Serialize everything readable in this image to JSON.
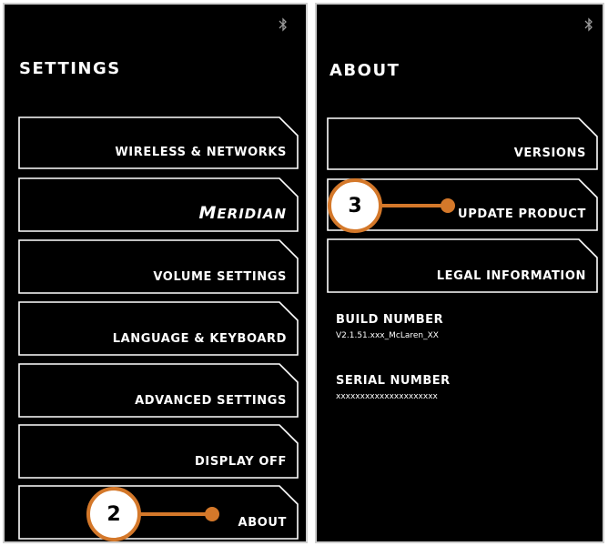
{
  "settings_panel": {
    "title": "SETTINGS",
    "bluetooth_icon": "bluetooth-icon",
    "menu": [
      {
        "label": "WIRELESS & NETWORKS"
      },
      {
        "label": "MERIDIAN"
      },
      {
        "label": "VOLUME SETTINGS"
      },
      {
        "label": "LANGUAGE & KEYBOARD"
      },
      {
        "label": "ADVANCED SETTINGS"
      },
      {
        "label": "DISPLAY OFF"
      },
      {
        "label": "ABOUT"
      }
    ]
  },
  "about_panel": {
    "title": "ABOUT",
    "bluetooth_icon": "bluetooth-icon",
    "menu": [
      {
        "label": "VERSIONS"
      },
      {
        "label": "UPDATE PRODUCT"
      },
      {
        "label": "LEGAL INFORMATION"
      }
    ],
    "build_number": {
      "label": "BUILD NUMBER",
      "value": "V2.1.51.xxx_McLaren_XX"
    },
    "serial_number": {
      "label": "SERIAL NUMBER",
      "value": "xxxxxxxxxxxxxxxxxxxxx"
    }
  },
  "callouts": [
    {
      "number": "2"
    },
    {
      "number": "3"
    }
  ],
  "colors": {
    "accent": "#d4782a",
    "panel_bg": "#000000",
    "outline": "#ffffff"
  }
}
